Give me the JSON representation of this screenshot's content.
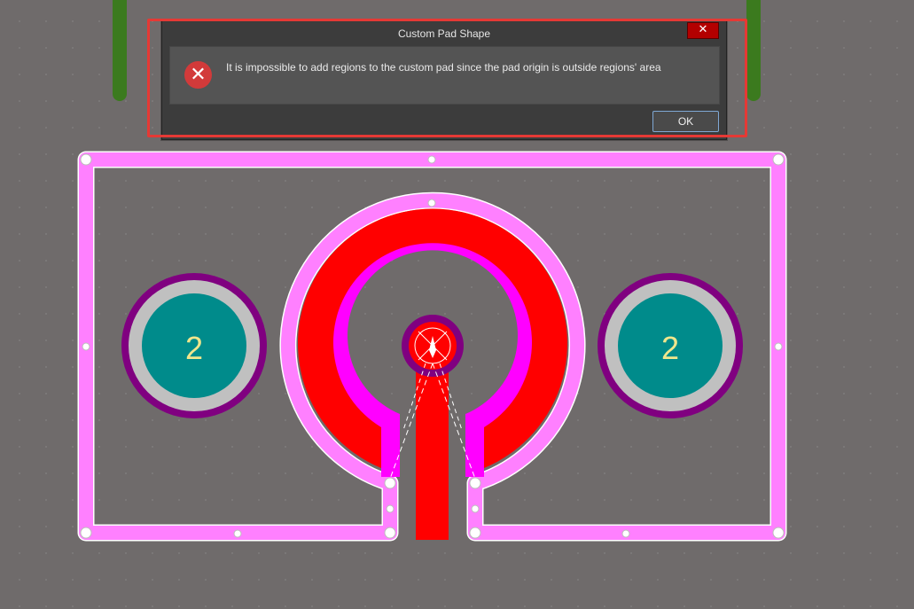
{
  "dialog": {
    "title": "Custom Pad Shape",
    "close_glyph": "✕",
    "icon": "error-icon",
    "message": "It is impossible to add regions to the custom pad since the pad origin is outside regions' area",
    "ok_label": "OK",
    "highlight_color": "#e53935"
  },
  "board": {
    "background_color": "#6f6b6b",
    "pads": [
      {
        "label": "2",
        "fill": "#008b8b"
      },
      {
        "label": "2",
        "fill": "#008b8b"
      }
    ],
    "colors": {
      "outline_region": "#ff80ff",
      "copper_red": "#ff0000",
      "magenta_ring": "#ff00ff",
      "pad_ring": "#800080",
      "pad_gray": "#c0c0c0",
      "pad_label": "#f0e68c",
      "green_trace": "#3b7a1e"
    }
  }
}
